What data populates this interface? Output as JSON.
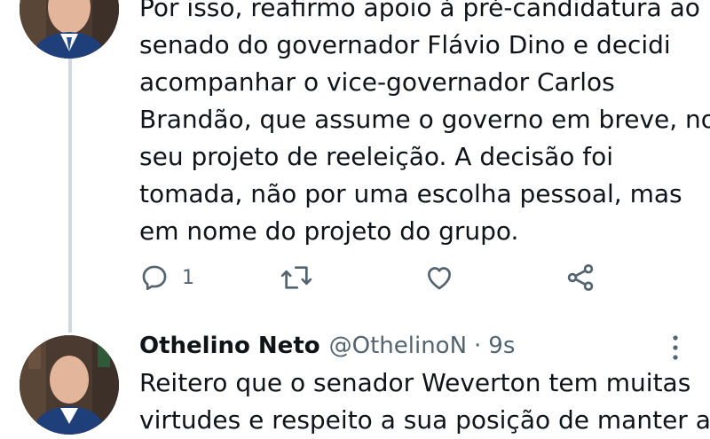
{
  "tweet1": {
    "author_avatar": "profile-photo",
    "text_lines": [
      "Por isso, reafirmo apoio à pré-candidatura ao",
      "senado do governador Flávio Dino e decidi",
      "acompanhar o vice-governador Carlos",
      "Brandão, que assume o governo em breve, no",
      "seu projeto de reeleição. A decisão foi",
      "tomada, não por uma escolha pessoal, mas",
      "em nome do projeto do grupo."
    ],
    "actions": {
      "reply_icon": "reply-icon",
      "reply_count": "1",
      "retweet_icon": "retweet-icon",
      "like_icon": "heart-icon",
      "share_icon": "share-icon"
    }
  },
  "tweet2": {
    "author_avatar": "profile-photo",
    "author_name": "Othelino Neto",
    "handle": "@OthelinoN",
    "separator": "·",
    "time": "9s",
    "more_icon": "more-vertical-icon",
    "text_lines": [
      "Reitero que o senador Weverton tem muitas",
      "virtudes e respeito a sua posição de manter a"
    ]
  },
  "colors": {
    "text_primary": "#0f1419",
    "text_secondary": "#536471",
    "thread_line": "#cfd9de",
    "icon": "#536471"
  }
}
